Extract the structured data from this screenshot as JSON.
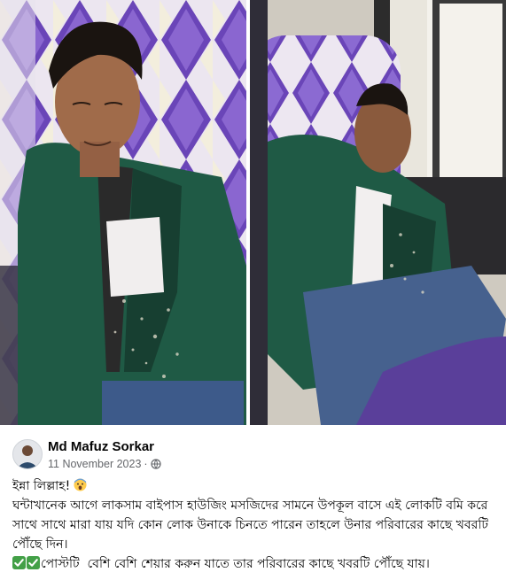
{
  "post": {
    "author": "Md Mafuz Sorkar",
    "date": "11 November 2023",
    "separator": "·",
    "privacy_icon": "globe-icon",
    "line1": "ইন্না লিল্লাহ!",
    "line1_emoji": "face-screaming-emoji",
    "line2": "ঘন্টাখানেক আগে লাকসাম বাইপাস হাউজিং মসজিদের সামনে উপকূল বাসে এই লোকটি বমি করে সাথে সাথে মারা যায় যদি কোন লোক উনাকে চিনতে পারেন তাহলে উনার পরিবারের কাছে খবরটি পৌঁছে দিন।",
    "line3_icons": [
      "check-mark-icon",
      "check-mark-icon"
    ],
    "line3": "পোস্টটি  বেশি বেশি শেয়ার করুন যাতে তার পরিবারের কাছে খবরটি পৌঁছে যায়।"
  },
  "photos": [
    {
      "name": "photo-left",
      "subject": "man-sleeping-on-bus-seat"
    },
    {
      "name": "photo-right",
      "subject": "man-slumped-against-bus-window"
    }
  ],
  "colors": {
    "text_primary": "#050505",
    "text_secondary": "#65676b",
    "check_green": "#43a047",
    "seat_purple": "#6a45b8",
    "shirt_green": "#1f5a45"
  }
}
